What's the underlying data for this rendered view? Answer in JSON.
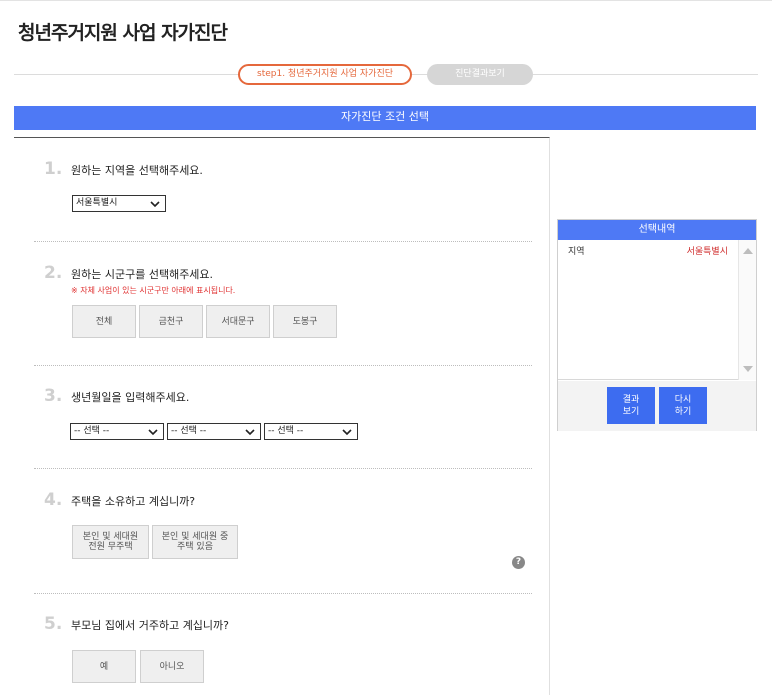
{
  "page": {
    "title": "청년주거지원 사업 자가진단"
  },
  "steps": [
    {
      "label": "step1. 청년주거지원 사업 자가진단",
      "active": true
    },
    {
      "label": "진단결과보기",
      "active": false
    }
  ],
  "banner": {
    "title": "자가진단 조건 선택"
  },
  "questions": {
    "q1": {
      "num": "1.",
      "text": "원하는 지역을 선택해주세요.",
      "select_value": "서울특별시"
    },
    "q2": {
      "num": "2.",
      "text": "원하는 시군구를 선택해주세요.",
      "note": "※ 자체 사업이 있는 시군구만 아래에 표시됩니다.",
      "options": [
        "전체",
        "금천구",
        "서대문구",
        "도봉구"
      ]
    },
    "q3": {
      "num": "3.",
      "text": "생년월일을 입력해주세요.",
      "selects": [
        "-- 선택 --",
        "-- 선택 --",
        "-- 선택 --"
      ]
    },
    "q4": {
      "num": "4.",
      "text": "주택을 소유하고 계십니까?",
      "options": [
        "본인 및 세대원\n전원 무주택",
        "본인 및 세대원 중\n주택 있음"
      ]
    },
    "q5": {
      "num": "5.",
      "text": "부모님 집에서 거주하고 계십니까?",
      "options": [
        "예",
        "아니오"
      ]
    }
  },
  "help": {
    "icon": "question-circle-icon",
    "glyph": "?"
  },
  "selection_panel": {
    "title": "선택내역",
    "items": [
      {
        "key": "지역",
        "value": "서울특별시"
      }
    ],
    "buttons": {
      "result": "결과\n보기",
      "reset": "다시\n하기"
    }
  },
  "colors": {
    "accent": "#4e79f5",
    "step_active": "#e5683c",
    "note": "#e03030",
    "button": "#3d6cf0"
  }
}
